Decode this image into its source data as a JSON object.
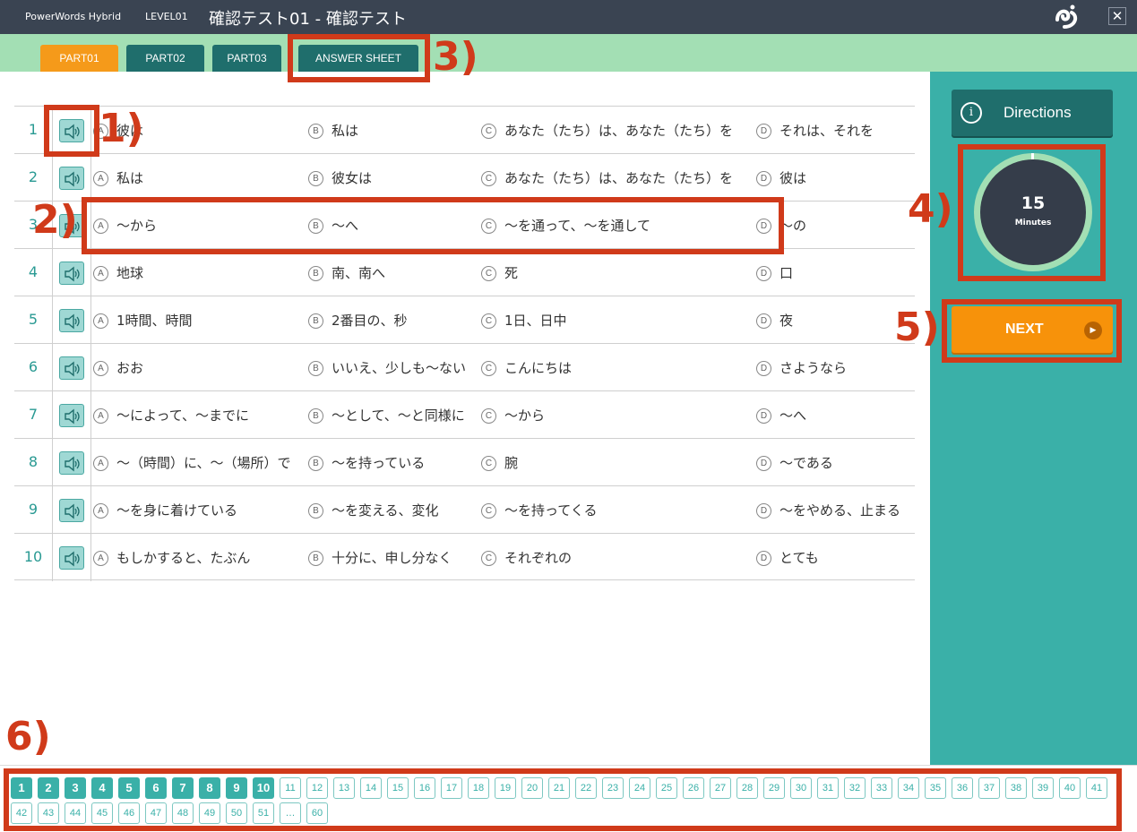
{
  "header": {
    "app_name": "PowerWords Hybrid",
    "level": "LEVEL01",
    "title": "確認テスト01 - 確認テスト",
    "close_label": "✕"
  },
  "tabs": [
    {
      "label": "PART01",
      "active": true
    },
    {
      "label": "PART02",
      "active": false
    },
    {
      "label": "PART03",
      "active": false
    },
    {
      "label": "ANSWER SHEET",
      "active": false
    }
  ],
  "side": {
    "directions_label": "Directions",
    "info_glyph": "i",
    "timer_value": "15",
    "timer_unit": "Minutes",
    "next_label": "NEXT",
    "next_glyph": "▶"
  },
  "option_letters": [
    "A",
    "B",
    "C",
    "D"
  ],
  "questions": [
    {
      "num": "1",
      "a": "彼は",
      "b": "私は",
      "c": "あなた（たち）は、あなた（たち）を",
      "d": "それは、それを"
    },
    {
      "num": "2",
      "a": "私は",
      "b": "彼女は",
      "c": "あなた（たち）は、あなた（たち）を",
      "d": "彼は"
    },
    {
      "num": "3",
      "a": "～から",
      "b": "～へ",
      "c": "～を通って、～を通して",
      "d": "～の"
    },
    {
      "num": "4",
      "a": "地球",
      "b": "南、南へ",
      "c": "死",
      "d": "口"
    },
    {
      "num": "5",
      "a": "1時間、時間",
      "b": "2番目の、秒",
      "c": "1日、日中",
      "d": "夜"
    },
    {
      "num": "6",
      "a": "おお",
      "b": "いいえ、少しも～ない",
      "c": "こんにちは",
      "d": "さようなら"
    },
    {
      "num": "7",
      "a": "～によって、～までに",
      "b": "～として、～と同様に",
      "c": "～から",
      "d": "～へ"
    },
    {
      "num": "8",
      "a": "～（時間）に、～（場所）で",
      "b": "～を持っている",
      "c": "腕",
      "d": "～である"
    },
    {
      "num": "9",
      "a": "～を身に着けている",
      "b": "～を変える、変化",
      "c": "～を持ってくる",
      "d": "～をやめる、止まる"
    },
    {
      "num": "10",
      "a": "もしかすると、たぶん",
      "b": "十分に、申し分なく",
      "c": "それぞれの",
      "d": "とても"
    }
  ],
  "pager": {
    "row1": [
      "1",
      "2",
      "3",
      "4",
      "5",
      "6",
      "7",
      "8",
      "9",
      "10",
      "11",
      "12",
      "13",
      "14",
      "15",
      "16",
      "17",
      "18",
      "19",
      "20",
      "21",
      "22",
      "23",
      "24",
      "25",
      "26",
      "27",
      "28",
      "29",
      "30",
      "31",
      "32",
      "33",
      "34",
      "35",
      "36",
      "37",
      "38",
      "39",
      "40",
      "41"
    ],
    "row2": [
      "42",
      "43",
      "44",
      "45",
      "46",
      "47",
      "48",
      "49",
      "50",
      "51",
      "…",
      "60"
    ],
    "answered_count": 10
  },
  "annotations": [
    "1)",
    "2)",
    "3)",
    "4)",
    "5)",
    "6)"
  ],
  "colors": {
    "accent_teal": "#3ab0a8",
    "tab_dark": "#1f6e6c",
    "orange": "#f59a1a",
    "annotation_red": "#d03a1a"
  }
}
